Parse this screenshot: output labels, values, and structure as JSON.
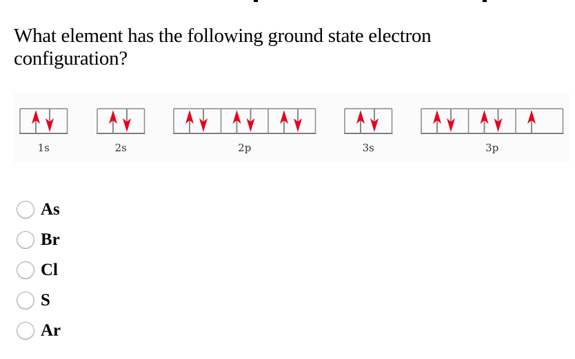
{
  "question": {
    "text": "What element has the following ground state electron configuration?"
  },
  "diagram": {
    "name": "orbital-diagram",
    "arrow_color": "#e8001e",
    "line_color": "#8a8a8a",
    "subshells": [
      {
        "label": "1s",
        "orbitals": [
          [
            "up",
            "down"
          ]
        ]
      },
      {
        "label": "2s",
        "orbitals": [
          [
            "up",
            "down"
          ]
        ]
      },
      {
        "label": "2p",
        "orbitals": [
          [
            "up",
            "down"
          ],
          [
            "up",
            "down"
          ],
          [
            "up",
            "down"
          ]
        ]
      },
      {
        "label": "3s",
        "orbitals": [
          [
            "up",
            "down"
          ]
        ]
      },
      {
        "label": "3p",
        "orbitals": [
          [
            "up",
            "down"
          ],
          [
            "up",
            "down"
          ],
          [
            "up"
          ]
        ]
      }
    ]
  },
  "options": [
    {
      "label": "As",
      "selected": false
    },
    {
      "label": "Br",
      "selected": false
    },
    {
      "label": "Cl",
      "selected": false
    },
    {
      "label": "S",
      "selected": false
    },
    {
      "label": "Ar",
      "selected": false
    }
  ]
}
